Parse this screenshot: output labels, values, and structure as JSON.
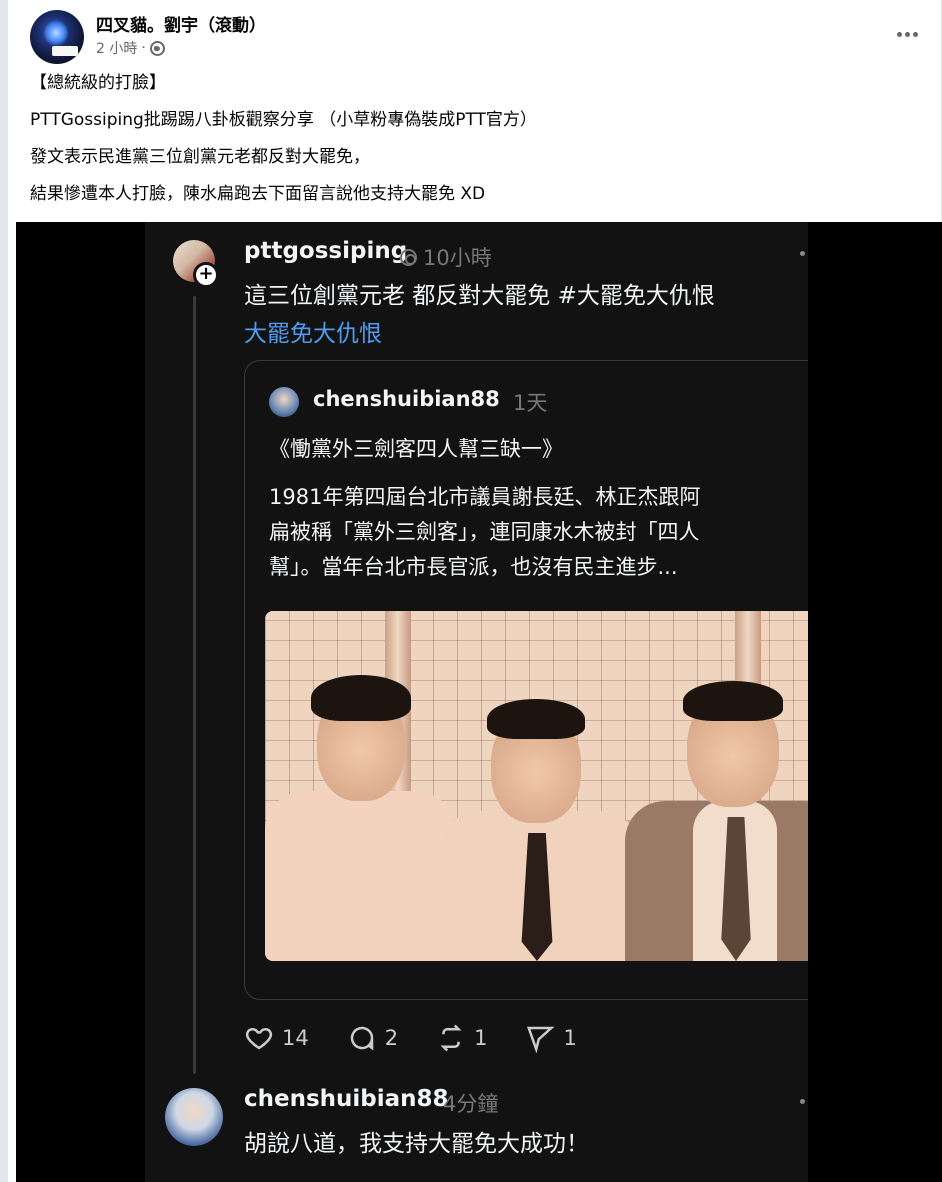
{
  "post": {
    "author": "四叉貓。劉宇（滾動）",
    "time": "2 小時",
    "separator": "·",
    "privacy_icon": "globe-icon",
    "more_icon": "more-horizontal-icon",
    "lines": [
      "【總統級的打臉】",
      "PTTGossiping批踢踢八卦板觀察分享 （小草粉專偽裝成PTT官方）",
      "發文表示民進黨三位創黨元老都反對大罷免，",
      "結果慘遭本人打臉，陳水扁跑去下面留言說他支持大罷免 XD"
    ]
  },
  "threads_post": {
    "username": "pttgossiping",
    "time": "10小時",
    "body": "這三位創黨元老 都反對大罷免 #大罷免大仇恨",
    "tag": "大罷免大仇恨",
    "quote": {
      "username": "chenshuibian88",
      "time": "1天",
      "title": "《慟黨外三劍客四人幫三缺一》",
      "text_lines": [
        "1981年第四屆台北市議員謝長廷、林正杰跟阿",
        "扁被稱「黨外三劍客」，連同康水木被封「四人",
        "幫」。當年台北市長官派，也沒有民主進步..."
      ]
    },
    "actions": {
      "likes": "14",
      "comments": "2",
      "reposts": "1",
      "shares": "1"
    }
  },
  "reply": {
    "username": "chenshuibian88",
    "time": "4分鐘",
    "body": "胡說八道，我支持大罷免大成功！"
  },
  "colors": {
    "fb_text": "#050505",
    "fb_meta": "#65676b",
    "threads_bg": "#121212",
    "threads_text": "#f3f5f7",
    "threads_muted": "#777777",
    "hashtag_link": "#4f9cf0"
  }
}
